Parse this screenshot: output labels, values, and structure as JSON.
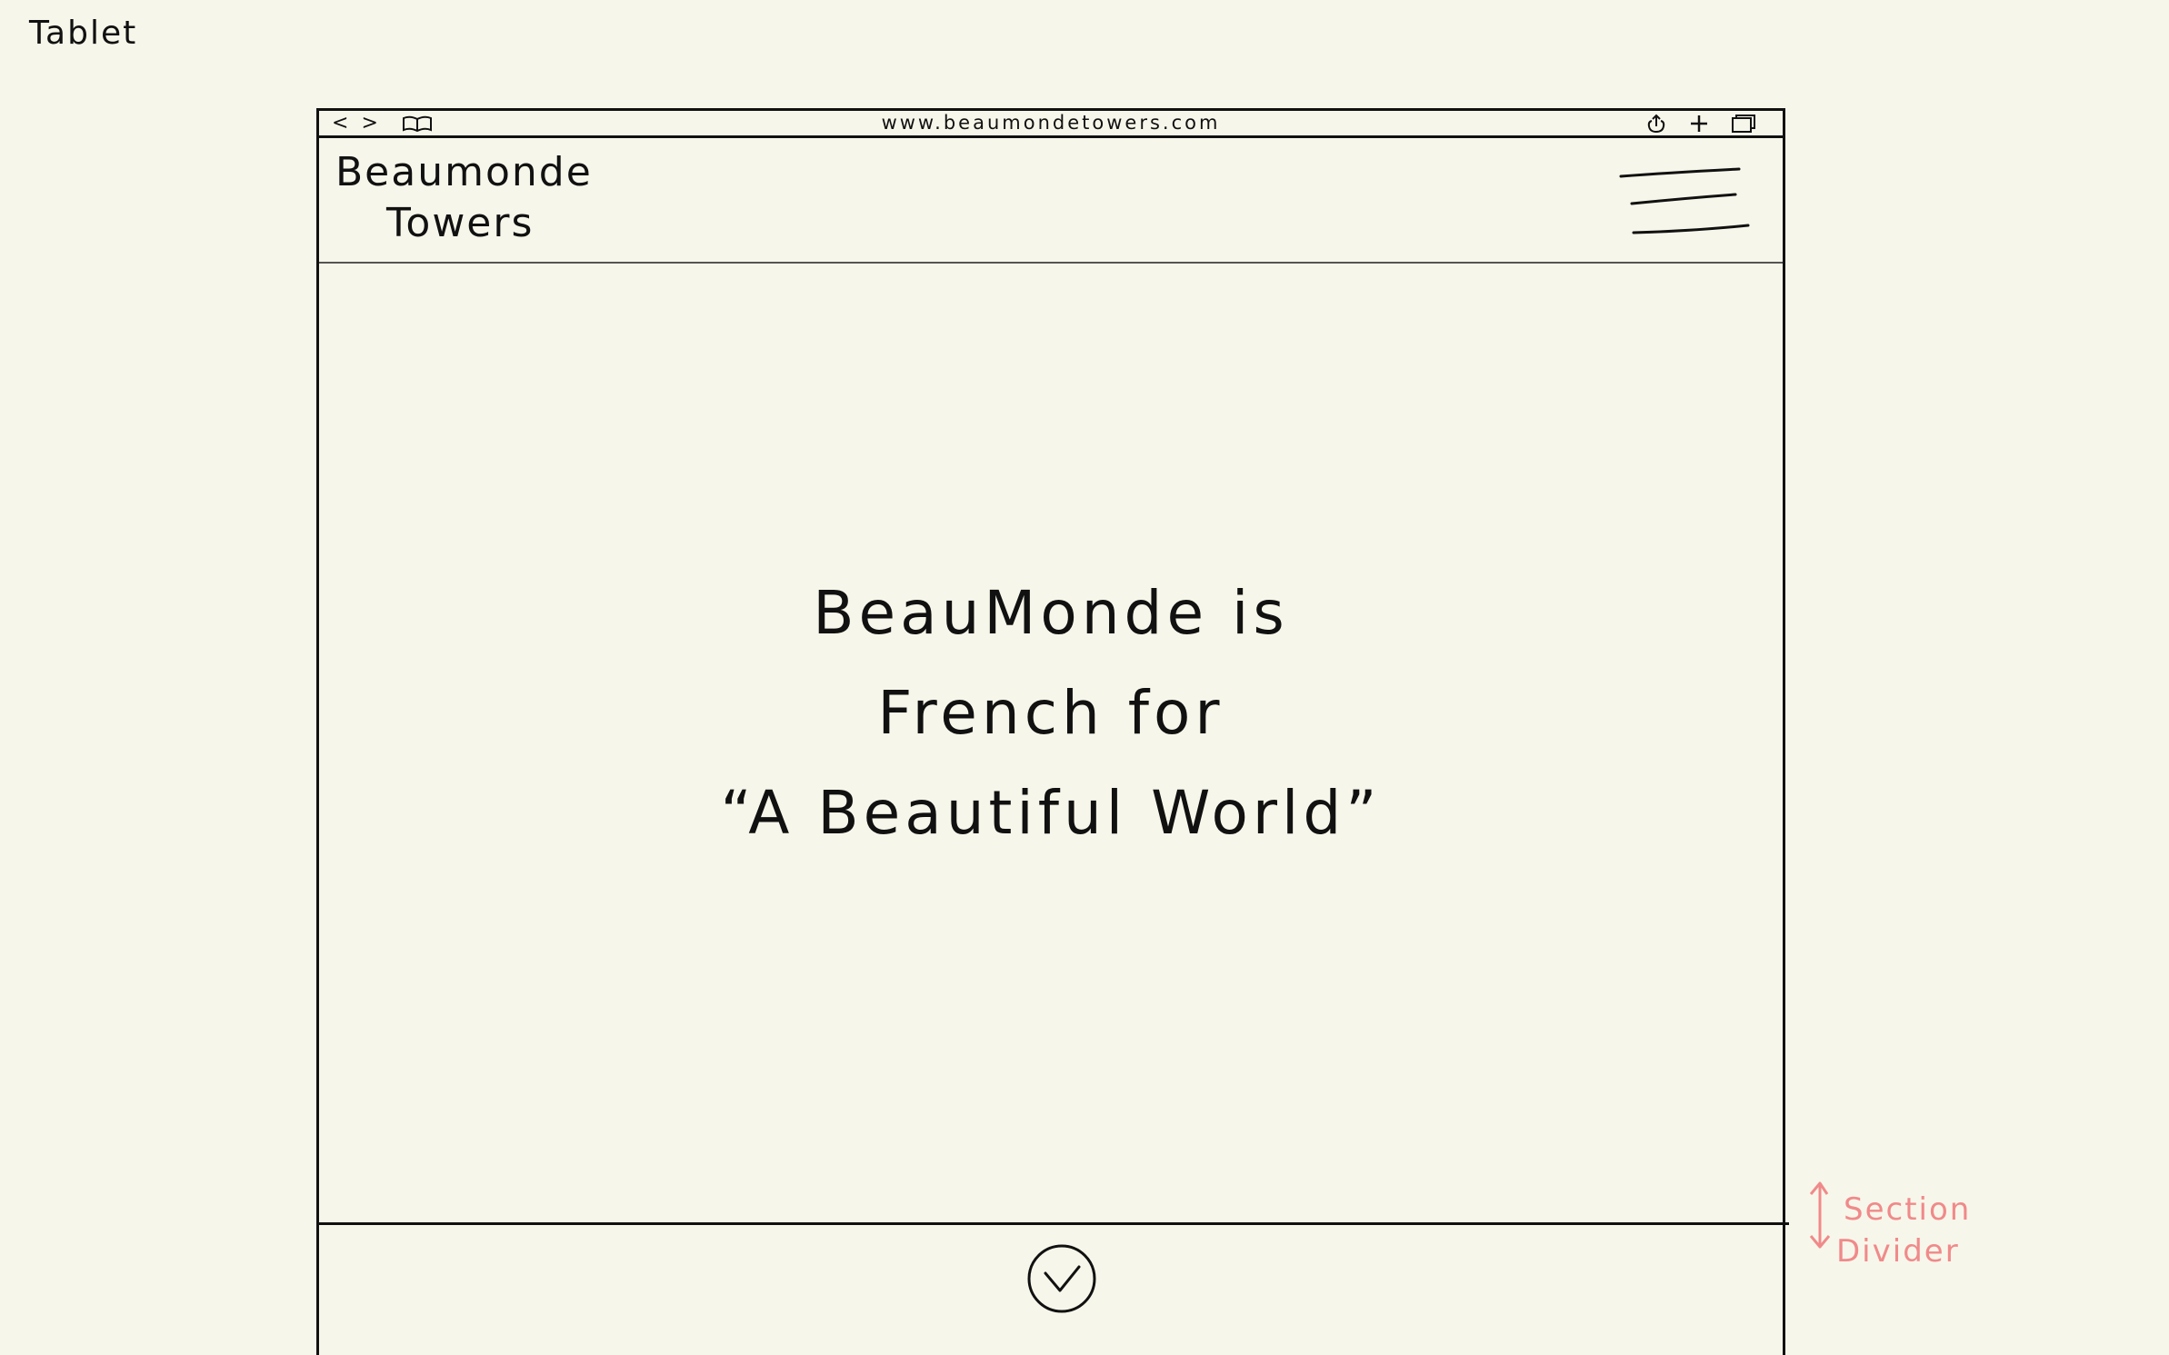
{
  "device_label": "Tablet",
  "browser": {
    "url": "www.beaumondetowers.com",
    "icons": {
      "back": "chevron-left-icon",
      "forward": "chevron-right-icon",
      "bookmarks": "open-book-icon",
      "share": "share-icon",
      "new_tab": "plus-icon",
      "tabs": "tabs-icon"
    },
    "back_glyph": "<",
    "forward_glyph": ">",
    "new_tab_glyph": "+"
  },
  "site": {
    "brand_line1": "Beaumonde",
    "brand_line2": "Towers",
    "menu_icon": "hamburger-menu-icon"
  },
  "hero": {
    "tagline_line1": "BeauMonde  is",
    "tagline_line2": "French  for",
    "tagline_line3": "“A  Beautiful  World”",
    "scroll_icon": "chevron-down-circle-icon"
  },
  "annotation": {
    "line1": "Section",
    "line2": "Divider",
    "color": "#f08a8a",
    "icon": "double-arrow-vertical-icon"
  }
}
